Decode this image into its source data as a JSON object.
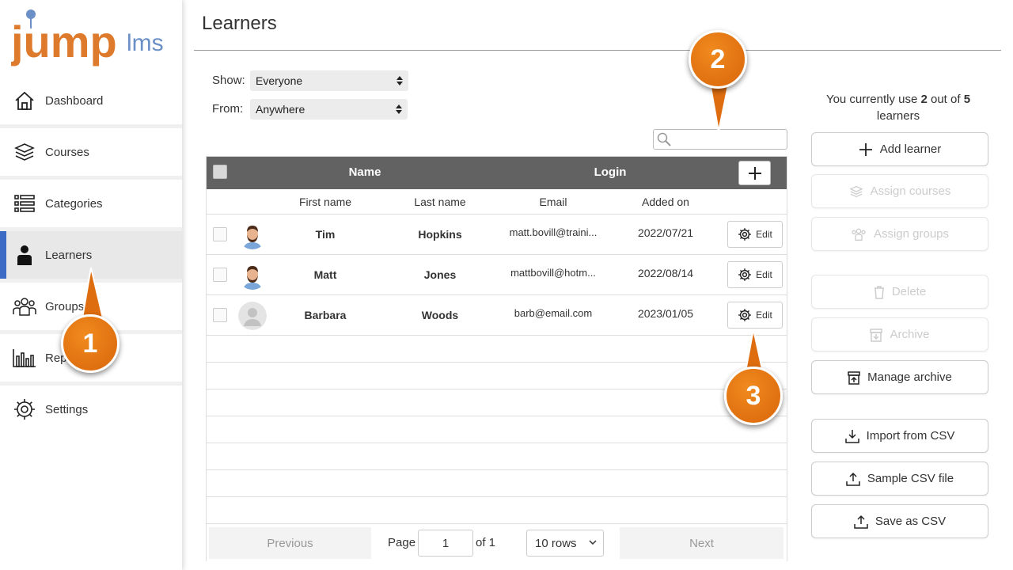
{
  "brand": {
    "logo_main": "jump",
    "logo_suffix": "lms"
  },
  "sidebar": {
    "items": [
      {
        "label": "Dashboard",
        "icon": "home-icon"
      },
      {
        "label": "Courses",
        "icon": "layers-icon"
      },
      {
        "label": "Categories",
        "icon": "list-icon"
      },
      {
        "label": "Learners",
        "icon": "person-icon",
        "active": true
      },
      {
        "label": "Groups",
        "icon": "group-icon"
      },
      {
        "label": "Rep",
        "icon": "bar-chart-icon"
      },
      {
        "label": "Settings",
        "icon": "gear-icon"
      }
    ]
  },
  "page": {
    "title": "Learners"
  },
  "filters": {
    "show_label": "Show:",
    "show_value": "Everyone",
    "from_label": "From:",
    "from_value": "Anywhere"
  },
  "search": {
    "placeholder": ""
  },
  "table": {
    "header_name": "Name",
    "header_login": "Login",
    "subheaders": {
      "first": "First name",
      "last": "Last name",
      "email": "Email",
      "added": "Added on"
    },
    "edit_label": "Edit",
    "rows": [
      {
        "first": "Tim",
        "last": "Hopkins",
        "email": "matt.bovill@traini...",
        "added": "2022/07/21",
        "avatar": "man"
      },
      {
        "first": "Matt",
        "last": "Jones",
        "email": "mattbovill@hotm...",
        "added": "2022/08/14",
        "avatar": "man"
      },
      {
        "first": "Barbara",
        "last": "Woods",
        "email": "barb@email.com",
        "added": "2023/01/05",
        "avatar": "placeholder"
      }
    ]
  },
  "pager": {
    "previous": "Previous",
    "page_label": "Page",
    "page_value": "1",
    "of_label": "of 1",
    "rows_select": "10 rows",
    "next": "Next"
  },
  "usage": {
    "prefix": "You currently use",
    "used": "2",
    "middle": "out of",
    "total": "5",
    "suffix": "learners"
  },
  "actions": {
    "add_learner": "Add learner",
    "assign_courses": "Assign courses",
    "assign_groups": "Assign groups",
    "delete": "Delete",
    "archive": "Archive",
    "manage_archive": "Manage archive",
    "import_csv": "Import from CSV",
    "sample_csv": "Sample CSV file",
    "save_csv": "Save as CSV"
  },
  "callouts": {
    "one": "1",
    "two": "2",
    "three": "3"
  },
  "colors": {
    "accent_orange": "#e5761a",
    "active_blue": "#3b6bc4",
    "header_gray": "#626262"
  }
}
